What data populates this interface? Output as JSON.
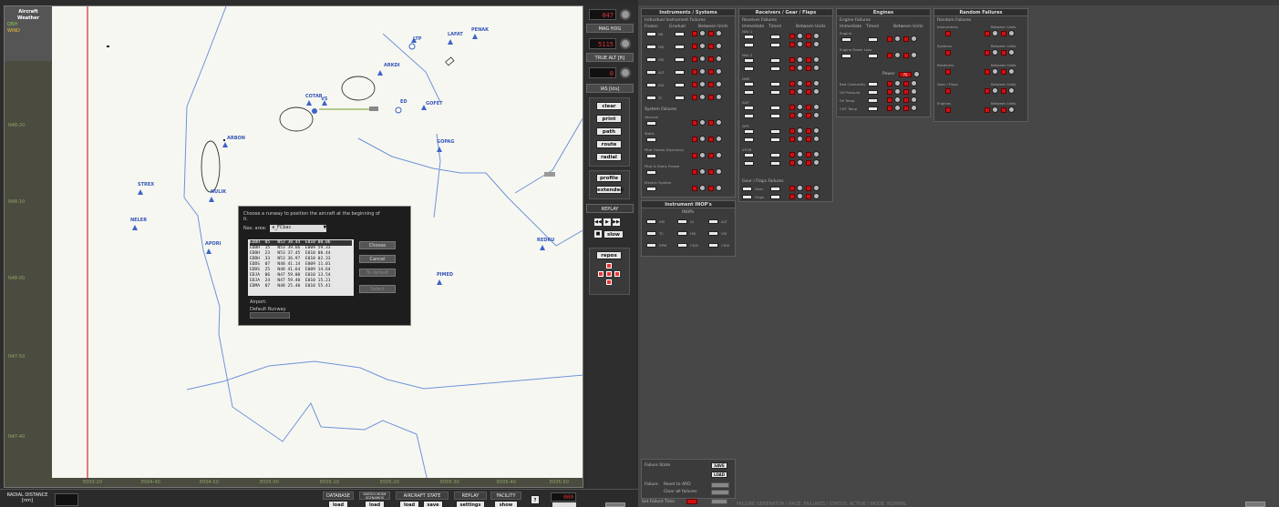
{
  "map": {
    "weather_box": {
      "title_line1": "Aircraft",
      "title_line2": "Weather",
      "line1": "QNH",
      "line2": "WIND"
    },
    "left_scale_labels": [
      "N48-20",
      "N48-10",
      "N48-00",
      "N47-50",
      "N47-40"
    ],
    "bottom_scale_labels": [
      "E003-20",
      "E004-40",
      "E004-50",
      "E005-00",
      "E005-10",
      "E005-20",
      "E005-30",
      "E005-40",
      "E005-50"
    ],
    "waypoints": [
      {
        "name": "LTP"
      },
      {
        "name": "LAFAT"
      },
      {
        "name": "PENAK"
      },
      {
        "name": "ARKDI"
      },
      {
        "name": "COTAR"
      },
      {
        "name": "VS"
      },
      {
        "name": "ED"
      },
      {
        "name": "GOFET"
      },
      {
        "name": "ARBON"
      },
      {
        "name": "GOPAG"
      },
      {
        "name": "STREX"
      },
      {
        "name": "NULIK"
      },
      {
        "name": "NELER"
      },
      {
        "name": "APORI"
      },
      {
        "name": "REDRU"
      },
      {
        "name": "PIMED"
      }
    ]
  },
  "dialog": {
    "message": "Choose a runway to position the aircraft at the beginning of it.",
    "airport_label": "Nav. area:",
    "airport_selected": "e_FCbac",
    "runways": [
      "EDDH  05   N53 38.44  E010 00.06",
      "EDDH  15   N53 39.66  E009 59.33",
      "EDDH  23   N53 37.45  E010 00.44",
      "EDDH  33   N53 36.97  E010 02.33",
      "EDDS  07   N48 41.14  E009 11.01",
      "EDDS  25   N48 41.64  E009 14.64",
      "EDJA  06   N47 59.00  E010 13.54",
      "EDJA  24   N47 59.40  E010 15.21",
      "EDMA  07   N48 25.40  E010 55.41"
    ],
    "buttons": {
      "choose": "Choose",
      "cancel": "Cancel",
      "to_default": "To default",
      "select": "Select"
    },
    "airport_field_label": "Airport:",
    "default_runway_label": "Default Runway"
  },
  "instruments": {
    "mag_hdg_value": "047",
    "mag_hdg_label": "MAG HDG",
    "true_alt_value": "5115",
    "true_alt_label": "TRUE ALT [ft]",
    "ias_value": "0",
    "ias_label": "IAS [kts]",
    "buttons1": [
      "clear",
      "print",
      "path",
      "route",
      "radial"
    ],
    "buttons2": [
      "profile",
      "extended"
    ],
    "replay_label": "REPLAY",
    "slow_label": "slow",
    "repos_label": "repos"
  },
  "bottom_bar": {
    "radial_distance_label": "RADIAL DISTANCE [nm]",
    "sections": [
      {
        "header": "DATABASE",
        "buttons": [
          "load"
        ]
      },
      {
        "header": "SWITCH MODE SCENARIOS",
        "buttons": [
          "load"
        ]
      },
      {
        "header": "AIRCRAFT STATE",
        "buttons": [
          "load",
          "save"
        ]
      },
      {
        "header": "REPLAY",
        "buttons": [
          "settings"
        ]
      },
      {
        "header": "FACILITY",
        "buttons": [
          "show"
        ]
      }
    ],
    "help_label": "?",
    "right_readout": "000"
  },
  "failures": {
    "instruments_systems": {
      "title": "Instruments / Systems",
      "subtitle": "Individual Instrument Failures",
      "col_labels": [
        "Frozen",
        "Gradual",
        "Between Units"
      ],
      "rows": [
        "NS",
        "HSI",
        "VSI",
        "ALT",
        "ASI",
        "TC"
      ],
      "system_title": "System Failures",
      "system_rows": [
        "Vacuum",
        "Static",
        "Pitot Freeze (Dynamic)",
        "Pitot & Static Freeze",
        "Electric System"
      ]
    },
    "receivers": {
      "title": "Receivers / Gear / Flaps",
      "subtitle": "Receiver Failures",
      "col_labels": [
        "Immediate",
        "Timed",
        "Between Units"
      ],
      "groups": [
        "NAV 1",
        "NAV 2",
        "DME",
        "ADF",
        "GPS",
        "VFOR"
      ],
      "gear_title": "Gear / Flaps Failures",
      "gear_rows": [
        "Gear",
        "Flaps"
      ]
    },
    "engines": {
      "title": "Engines",
      "subtitle": "Engine Failures",
      "col_labels": [
        "Immediate",
        "Timed",
        "Between Units"
      ],
      "rows": [
        "Engine",
        "Engine Power Loss"
      ],
      "power_label": "Power",
      "power_value": "75",
      "misc_rows": [
        "Bad Carburettor",
        "Oil Pressure",
        "Oil Temp",
        "CHT Temp"
      ]
    },
    "random": {
      "title": "Random Failures",
      "subtitle": "Random Failures",
      "rows": [
        "Instruments",
        "Systems",
        "Receivers",
        "Gear / Flaps",
        "Engines"
      ],
      "col_label": "Between Units"
    },
    "instrument_inops": {
      "title": "Instrument INOP's",
      "subtitle": "INOPs",
      "items": [
        "ASI",
        "AI",
        "ALT",
        "TC",
        "HSI",
        "VSI",
        "RPM",
        "CDI1",
        "CDI2"
      ]
    },
    "failure_state": {
      "title": "Failure State",
      "save": "SAVE",
      "load": "LOAD",
      "failure_label": "Failure",
      "reset_label": "Reset to ARO",
      "clear_label": "Clear all failures",
      "set_label": "Set Failure Time"
    }
  },
  "status_text": "FAILURE GENERATOR / PAGE: FAILURES / STATUS: ACTIVE / MODE: NORMAL",
  "colors": {
    "accent_red": "#cc2222",
    "waypoint_blue": "#3d63c9",
    "route_blue": "#4a74c8",
    "airway_line": "#7a9a3a"
  }
}
